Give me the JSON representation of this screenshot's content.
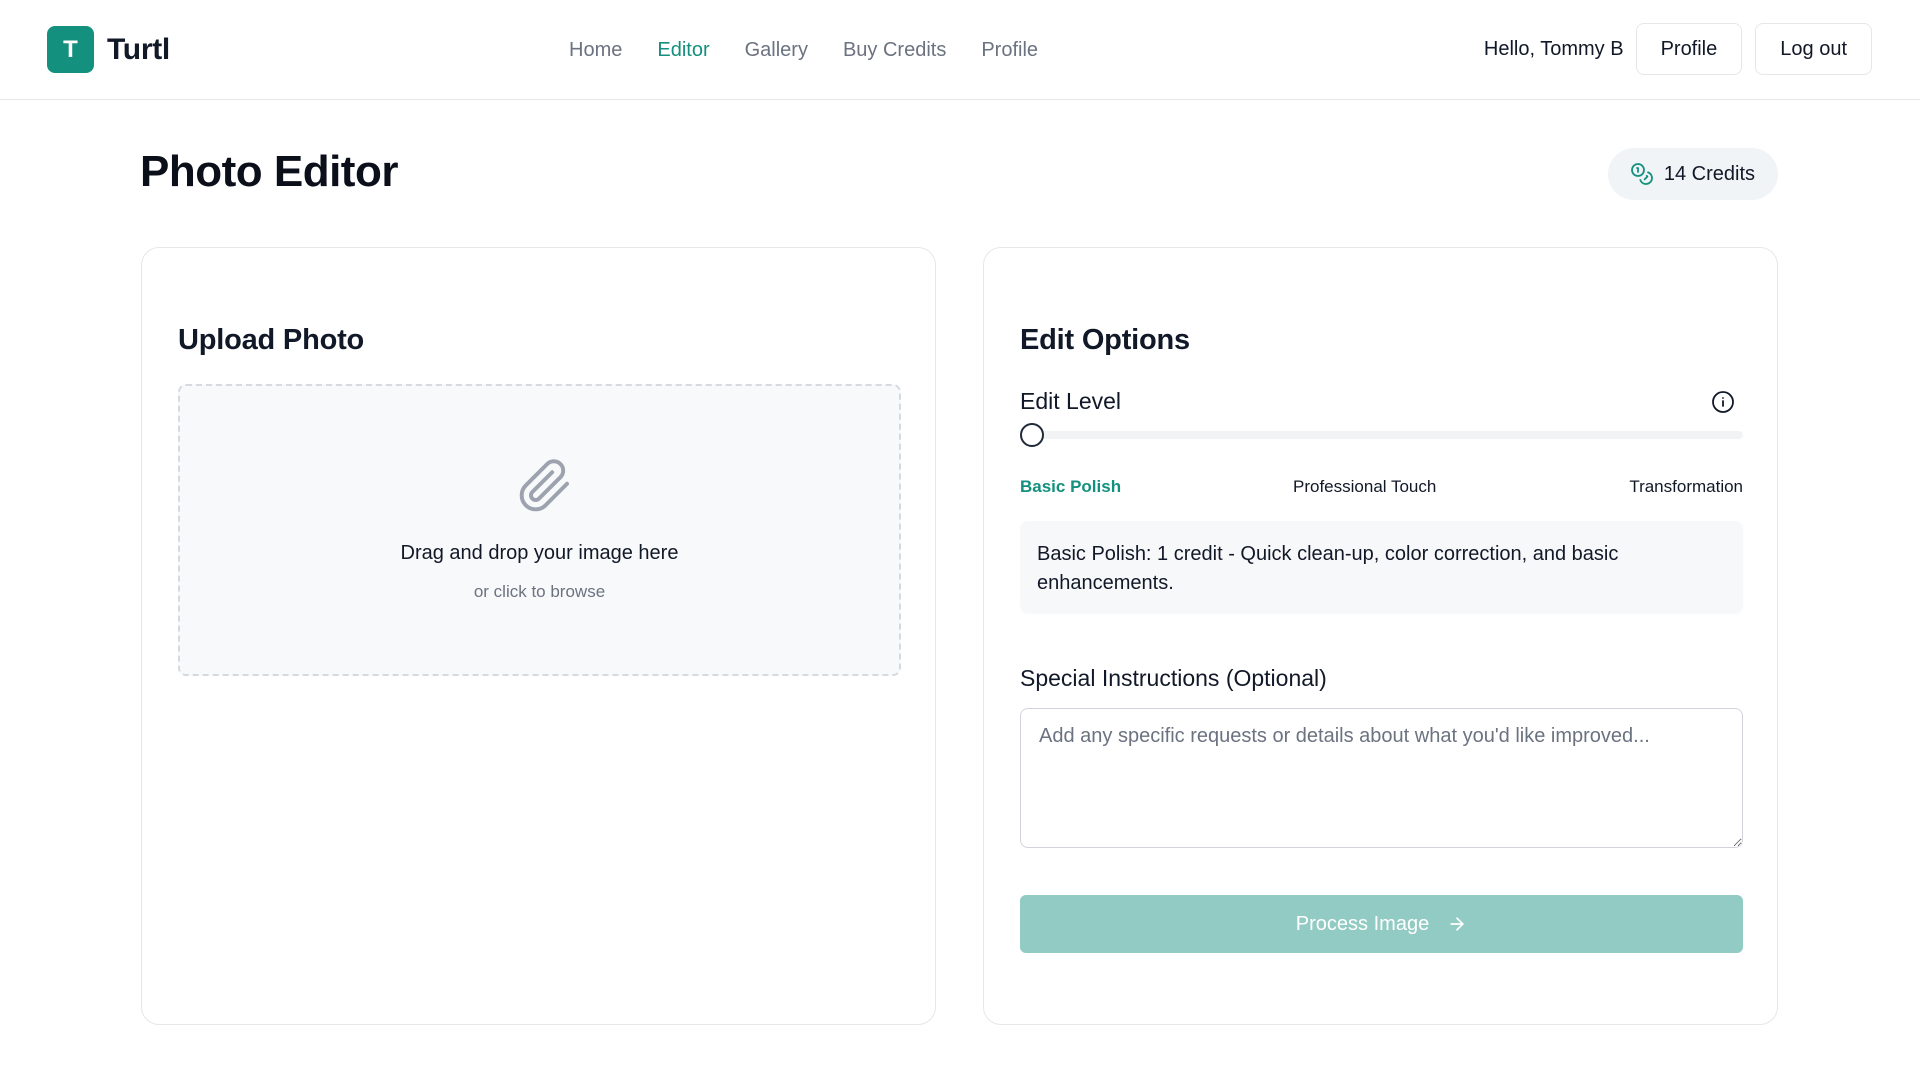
{
  "header": {
    "brand_initial": "T",
    "brand_name": "Turtl",
    "nav": [
      {
        "label": "Home",
        "active": false
      },
      {
        "label": "Editor",
        "active": true
      },
      {
        "label": "Gallery",
        "active": false
      },
      {
        "label": "Buy Credits",
        "active": false
      },
      {
        "label": "Profile",
        "active": false
      }
    ],
    "greeting": "Hello, Tommy B",
    "profile_button": "Profile",
    "logout_button": "Log out"
  },
  "page": {
    "title": "Photo Editor",
    "credits": "14 Credits",
    "credits_icon": "coins-icon"
  },
  "upload": {
    "title": "Upload Photo",
    "icon": "paperclip-icon",
    "drop_title": "Drag and drop your image here",
    "drop_sub": "or click to browse"
  },
  "edit": {
    "title": "Edit Options",
    "level_label": "Edit Level",
    "info_icon": "info-icon",
    "levels": [
      "Basic Polish",
      "Professional Touch",
      "Transformation"
    ],
    "selected_level": "Basic Polish",
    "level_description": "Basic Polish: 1 credit - Quick clean-up, color correction, and basic enhancements.",
    "instructions_label": "Special Instructions (Optional)",
    "instructions_placeholder": "Add any specific requests or details about what you'd like improved...",
    "instructions_value": "",
    "process_button": "Process Image",
    "process_icon": "arrow-right-icon"
  },
  "colors": {
    "accent": "#14907e",
    "button_disabled": "#92cbc3",
    "border": "#e5e7eb",
    "muted_text": "#6b7280"
  }
}
